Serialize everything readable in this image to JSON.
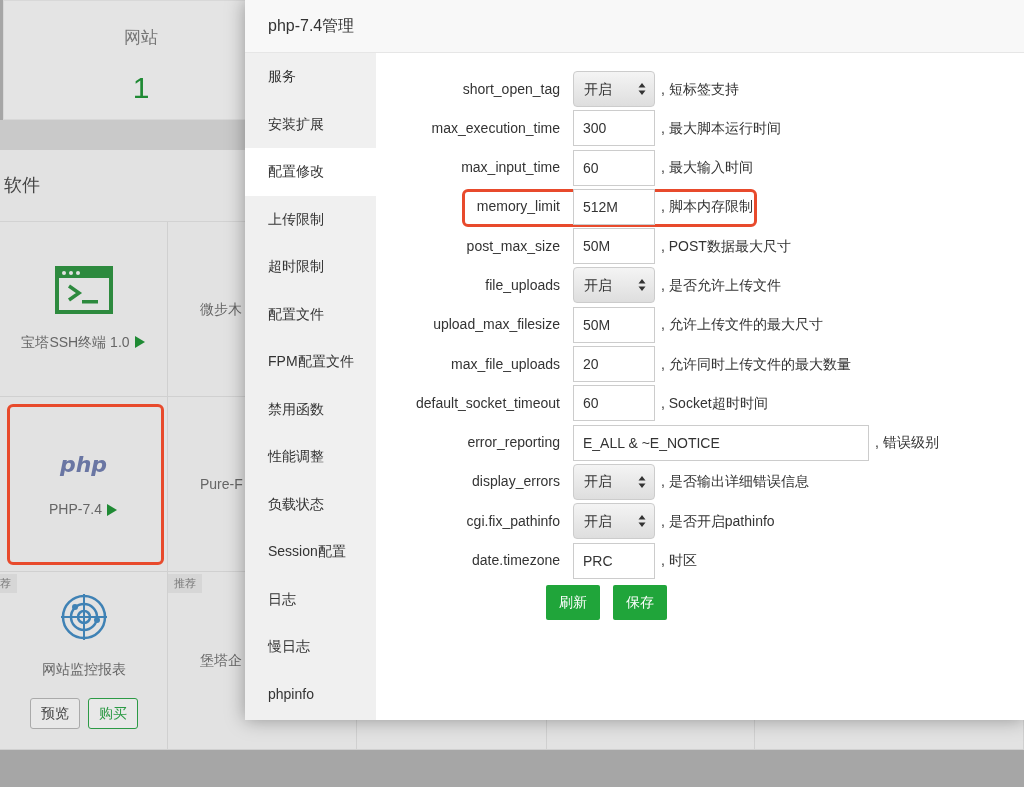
{
  "background": {
    "stat_card": {
      "label": "网站",
      "value": "1"
    },
    "software_panel": {
      "title": "软件",
      "apps": [
        {
          "kind": "terminal",
          "name": "宝塔SSH终端 1.0",
          "play": true,
          "highlighted": false
        },
        {
          "kind": "blank",
          "name": "微步木",
          "play": false,
          "highlighted": false
        },
        {
          "kind": "php",
          "logo_text": "php",
          "name": "PHP-7.4",
          "play": true,
          "highlighted": true
        },
        {
          "kind": "blank",
          "name": "Pure-F",
          "play": false,
          "highlighted": false
        },
        {
          "kind": "radar",
          "tag": "荐",
          "name": "网站监控报表",
          "buttons": [
            "预览",
            "购买"
          ],
          "highlighted": false
        },
        {
          "kind": "blank",
          "tag": "推荐",
          "name": "堡塔企",
          "highlighted": false
        }
      ]
    }
  },
  "dialog": {
    "title": "php-7.4管理",
    "sidebar": {
      "items": [
        {
          "label": "服务",
          "selected": false
        },
        {
          "label": "安装扩展",
          "selected": false
        },
        {
          "label": "配置修改",
          "selected": true
        },
        {
          "label": "上传限制",
          "selected": false
        },
        {
          "label": "超时限制",
          "selected": false
        },
        {
          "label": "配置文件",
          "selected": false
        },
        {
          "label": "FPM配置文件",
          "selected": false
        },
        {
          "label": "禁用函数",
          "selected": false
        },
        {
          "label": "性能调整",
          "selected": false
        },
        {
          "label": "负载状态",
          "selected": false
        },
        {
          "label": "Session配置",
          "selected": false
        },
        {
          "label": "日志",
          "selected": false
        },
        {
          "label": "慢日志",
          "selected": false
        },
        {
          "label": "phpinfo",
          "selected": false
        }
      ]
    },
    "settings": [
      {
        "label": "short_open_tag",
        "kind": "select",
        "value": "开启",
        "note": ", 短标签支持",
        "highlighted": false
      },
      {
        "label": "max_execution_time",
        "kind": "input",
        "value": "300",
        "note": ", 最大脚本运行时间",
        "highlighted": false
      },
      {
        "label": "max_input_time",
        "kind": "input",
        "value": "60",
        "note": ", 最大输入时间",
        "highlighted": false
      },
      {
        "label": "memory_limit",
        "kind": "input",
        "value": "512M",
        "note": ", 脚本内存限制",
        "highlighted": true
      },
      {
        "label": "post_max_size",
        "kind": "input",
        "value": "50M",
        "note": ", POST数据最大尺寸",
        "highlighted": false
      },
      {
        "label": "file_uploads",
        "kind": "select",
        "value": "开启",
        "note": ", 是否允许上传文件",
        "highlighted": false
      },
      {
        "label": "upload_max_filesize",
        "kind": "input",
        "value": "50M",
        "note": ", 允许上传文件的最大尺寸",
        "highlighted": false
      },
      {
        "label": "max_file_uploads",
        "kind": "input",
        "value": "20",
        "note": ", 允许同时上传文件的最大数量",
        "highlighted": false
      },
      {
        "label": "default_socket_timeout",
        "kind": "input",
        "value": "60",
        "note": ", Socket超时时间",
        "highlighted": false
      },
      {
        "label": "error_reporting",
        "kind": "wide_input",
        "value": "E_ALL & ~E_NOTICE",
        "note": ", 错误级别",
        "highlighted": false
      },
      {
        "label": "display_errors",
        "kind": "select",
        "value": "开启",
        "note": ", 是否输出详细错误信息",
        "highlighted": false
      },
      {
        "label": "cgi.fix_pathinfo",
        "kind": "select",
        "value": "开启",
        "note": ", 是否开启pathinfo",
        "highlighted": false
      },
      {
        "label": "date.timezone",
        "kind": "input",
        "value": "PRC",
        "note": ", 时区",
        "highlighted": false
      }
    ],
    "buttons": [
      "刷新",
      "保存"
    ]
  }
}
